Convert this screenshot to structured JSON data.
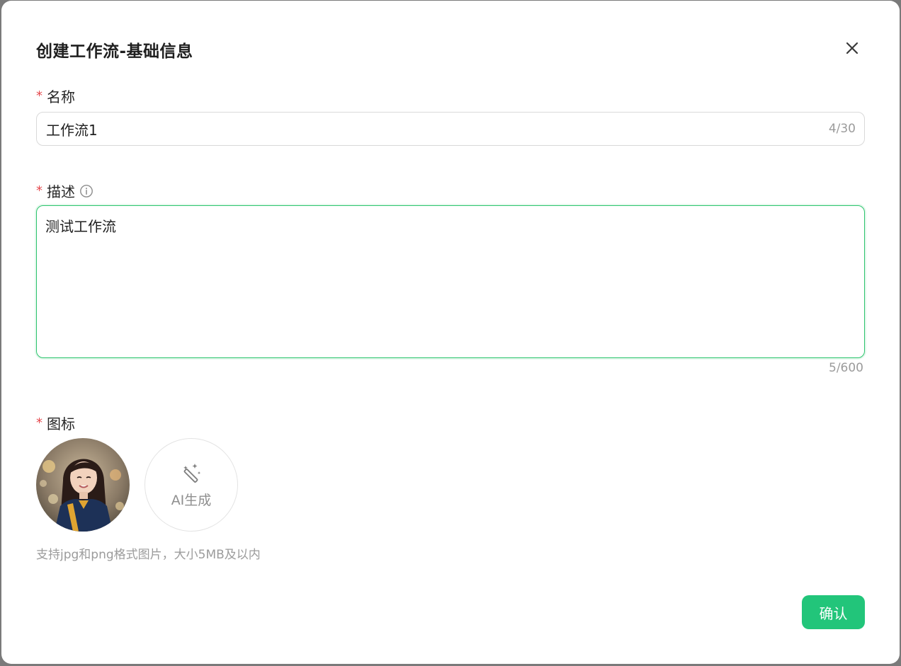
{
  "dialog": {
    "title": "创建工作流-基础信息",
    "close_icon": "close-icon"
  },
  "form": {
    "required_mark": "*",
    "name": {
      "label": "名称",
      "value": "工作流1",
      "counter": "4/30"
    },
    "description": {
      "label": "描述",
      "info_icon": "info-icon",
      "value": "测试工作流",
      "counter": "5/600"
    },
    "icon": {
      "label": "图标",
      "ai_generate_label": "AI生成",
      "ai_icon": "magic-wand-icon",
      "hint": "支持jpg和png格式图片，大小5MB及以内"
    }
  },
  "footer": {
    "confirm_label": "确认"
  },
  "colors": {
    "accent": "#22c57a",
    "focus_border": "#2cc46d",
    "required": "#e5484d"
  }
}
